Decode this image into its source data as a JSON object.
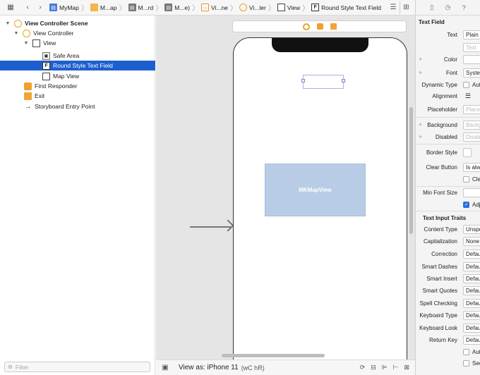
{
  "breadcrumb": {
    "items": [
      {
        "label": "MyMap",
        "icon": "project-icon"
      },
      {
        "label": "M...ap",
        "icon": "folder-icon"
      },
      {
        "label": "M...rd",
        "icon": "file-icon"
      },
      {
        "label": "M...e)",
        "icon": "file-icon"
      },
      {
        "label": "Vi...ne",
        "icon": "storyboard-icon"
      },
      {
        "label": "Vi...ler",
        "icon": "view-controller-icon"
      },
      {
        "label": "View",
        "icon": "view-icon"
      },
      {
        "label": "Round Style Text Field",
        "icon": "text-field-icon"
      }
    ]
  },
  "outline": {
    "items": [
      {
        "label": "View Controller Scene",
        "indent": 0,
        "expanded": true,
        "bold": true
      },
      {
        "label": "View Controller",
        "indent": 1,
        "expanded": true
      },
      {
        "label": "View",
        "indent": 2,
        "expanded": true
      },
      {
        "label": "Safe Area",
        "indent": 3
      },
      {
        "label": "Round Style Text Field",
        "indent": 3,
        "selected": true
      },
      {
        "label": "Map View",
        "indent": 3
      },
      {
        "label": "First Responder",
        "indent": 1
      },
      {
        "label": "Exit",
        "indent": 1
      },
      {
        "label": "Storyboard Entry Point",
        "indent": 1
      }
    ],
    "filter_placeholder": "Filter"
  },
  "canvas": {
    "map_view_label": "MKMapView"
  },
  "bottom_bar": {
    "view_as": "View as: iPhone 11",
    "size_class": "(wC hR)"
  },
  "inspector": {
    "section_title": "Text Field",
    "props": {
      "text_label": "Text",
      "text_value": "Plain",
      "text_placeholder": "Text",
      "color_label": "Color",
      "font_label": "Font",
      "font_value": "System",
      "dynamic_type_label": "Dynamic Type",
      "dynamic_type_check": "Autom",
      "alignment_label": "Alignment",
      "placeholder_label": "Placeholder",
      "placeholder_value": "Placeholder",
      "background_label": "Background",
      "background_value": "Background",
      "disabled_label": "Disabled",
      "disabled_value": "Disabled",
      "border_style_label": "Border Style",
      "clear_button_label": "Clear Button",
      "clear_button_value": "Is always",
      "clear_check": "Clear",
      "min_font_label": "Min Font Size",
      "adjust_check": "Adjust"
    },
    "traits_title": "Text Input Traits",
    "traits": [
      {
        "label": "Content Type",
        "value": "Unspecified"
      },
      {
        "label": "Capitalization",
        "value": "None"
      },
      {
        "label": "Correction",
        "value": "Default"
      },
      {
        "label": "Smart Dashes",
        "value": "Default"
      },
      {
        "label": "Smart Insert",
        "value": "Default"
      },
      {
        "label": "Smart Quotes",
        "value": "Default"
      },
      {
        "label": "Spell Checking",
        "value": "Default"
      },
      {
        "label": "Keyboard Type",
        "value": "Default"
      },
      {
        "label": "Keyboard Look",
        "value": "Default"
      },
      {
        "label": "Return Key",
        "value": "Default"
      }
    ],
    "trait_checks": [
      "Auto",
      "Secure"
    ]
  }
}
